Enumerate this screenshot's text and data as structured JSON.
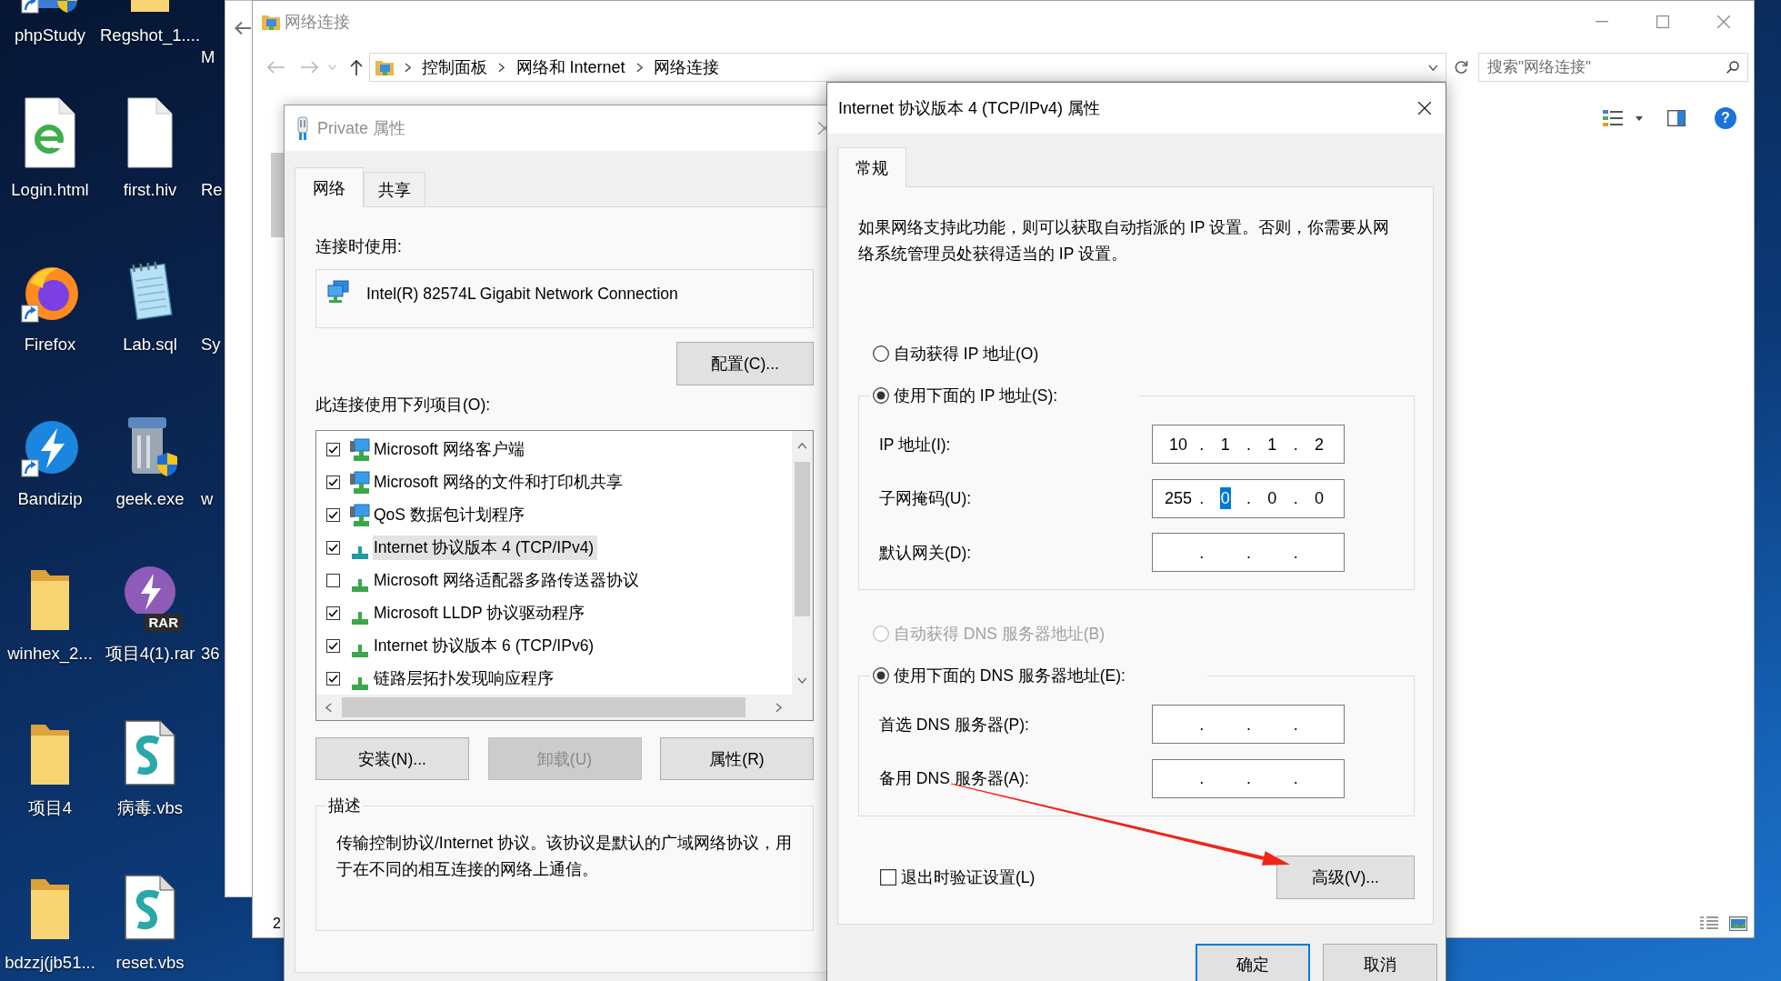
{
  "desktop": {
    "icons": [
      {
        "label": "phpStudy",
        "kind": "app",
        "shortcut": true,
        "shield": true
      },
      {
        "label": "Login.html",
        "kind": "web-page",
        "shortcut": false,
        "shield": false
      },
      {
        "label": "Firefox",
        "kind": "browser",
        "shortcut": true,
        "shield": false
      },
      {
        "label": "Bandizip",
        "kind": "bolt-app",
        "shortcut": true,
        "shield": false
      },
      {
        "label": "winhex_2...",
        "kind": "folder",
        "shortcut": false,
        "shield": false
      },
      {
        "label": "项目4",
        "kind": "folder",
        "shortcut": false,
        "shield": false
      },
      {
        "label": "bdzzj(jb51...",
        "kind": "folder",
        "shortcut": false,
        "shield": false
      },
      {
        "label": "Regshot_1....",
        "kind": "folder",
        "shortcut": false,
        "shield": false
      },
      {
        "label": "first.hiv",
        "kind": "file",
        "shortcut": false,
        "shield": false
      },
      {
        "label": "Lab.sql",
        "kind": "notepad",
        "shortcut": false,
        "shield": false
      },
      {
        "label": "geek.exe",
        "kind": "trash",
        "shortcut": false,
        "shield": true
      },
      {
        "label": "项目4(1).rar",
        "kind": "archive",
        "badge": "RAR",
        "shortcut": false,
        "shield": false
      },
      {
        "label": "病毒.vbs",
        "kind": "script",
        "shortcut": false,
        "shield": false
      },
      {
        "label": "reset.vbs",
        "kind": "script",
        "shortcut": false,
        "shield": false
      }
    ],
    "partly_hidden_labels": [
      "M",
      "Re",
      "Sy",
      "w",
      "36"
    ]
  },
  "explorer": {
    "title": "网络连接",
    "breadcrumbs": [
      "控制面板",
      "网络和 Internet",
      "网络连接"
    ],
    "search": {
      "placeholder": "搜索\"网络连接\""
    },
    "help": "?",
    "status": "2"
  },
  "private_dialog": {
    "title": "Private 属性",
    "tabs": [
      {
        "label": "网络",
        "selected": true
      },
      {
        "label": "共享",
        "selected": false
      }
    ],
    "connect_using_label": "连接时使用:",
    "adapter": "Intel(R) 82574L Gigabit Network Connection",
    "configure_button": "配置(C)...",
    "items_label": "此连接使用下列项目(O):",
    "items": [
      {
        "label": "Microsoft 网络客户端",
        "kind": "client",
        "checked": true,
        "selected": false
      },
      {
        "label": "Microsoft 网络的文件和打印机共享",
        "kind": "client",
        "checked": true,
        "selected": false
      },
      {
        "label": "QoS 数据包计划程序",
        "kind": "client",
        "checked": true,
        "selected": false
      },
      {
        "label": "Internet 协议版本 4 (TCP/IPv4)",
        "kind": "protocol",
        "checked": true,
        "selected": true
      },
      {
        "label": "Microsoft 网络适配器多路传送器协议",
        "kind": "protocol",
        "checked": false,
        "selected": false
      },
      {
        "label": "Microsoft LLDP 协议驱动程序",
        "kind": "protocol",
        "checked": true,
        "selected": false
      },
      {
        "label": "Internet 协议版本 6 (TCP/IPv6)",
        "kind": "protocol",
        "checked": true,
        "selected": false
      },
      {
        "label": "链路层拓扑发现响应程序",
        "kind": "protocol",
        "checked": true,
        "selected": false
      }
    ],
    "buttons": [
      {
        "label": "安装(N)...",
        "disabled": false
      },
      {
        "label": "卸载(U)",
        "disabled": true
      },
      {
        "label": "属性(R)",
        "disabled": false
      }
    ],
    "description": {
      "title": "描述",
      "text": "传输控制协议/Internet 协议。该协议是默认的广域网络协议，用于在不同的相互连接的网络上通信。"
    }
  },
  "tcp_dialog": {
    "title": "Internet 协议版本 4 (TCP/IPv4) 属性",
    "tabs": [
      {
        "label": "常规",
        "selected": true
      }
    ],
    "intro": "如果网络支持此功能，则可以获取自动指派的 IP 设置。否则，你需要从网络系统管理员处获得适当的 IP 设置。",
    "sections": [
      {
        "options": [
          {
            "label": "自动获得 IP 地址(O)",
            "selected": false,
            "disabled": false
          },
          {
            "label": "使用下面的 IP 地址(S):",
            "selected": true,
            "disabled": false
          }
        ],
        "fields": [
          {
            "label": "IP 地址(I):",
            "octets": [
              {
                "text": "10",
                "selected": false
              },
              {
                "text": "1",
                "selected": false
              },
              {
                "text": "1",
                "selected": false
              },
              {
                "text": "2",
                "selected": false
              }
            ],
            "dots": [
              ".",
              ".",
              "."
            ]
          },
          {
            "label": "子网掩码(U):",
            "octets": [
              {
                "text": "255",
                "selected": false
              },
              {
                "text": "0",
                "selected": true
              },
              {
                "text": "0",
                "selected": false
              },
              {
                "text": "0",
                "selected": false
              }
            ],
            "dots": [
              ".",
              ".",
              "."
            ]
          },
          {
            "label": "默认网关(D):",
            "dots": [
              ".",
              ".",
              "."
            ]
          }
        ]
      },
      {
        "options": [
          {
            "label": "自动获得 DNS 服务器地址(B)",
            "selected": false,
            "disabled": true
          },
          {
            "label": "使用下面的 DNS 服务器地址(E):",
            "selected": true,
            "disabled": false
          }
        ],
        "fields": [
          {
            "label": "首选 DNS 服务器(P):",
            "dots": [
              ".",
              ".",
              "."
            ]
          },
          {
            "label": "备用 DNS 服务器(A):",
            "dots": [
              ".",
              ".",
              "."
            ]
          }
        ]
      }
    ],
    "verify_on_exit": {
      "label": "退出时验证设置(L)",
      "checked": false
    },
    "advanced_button": "高级(V)...",
    "buttons": [
      {
        "label": "确定",
        "default": true
      },
      {
        "label": "取消",
        "default": false
      }
    ]
  }
}
